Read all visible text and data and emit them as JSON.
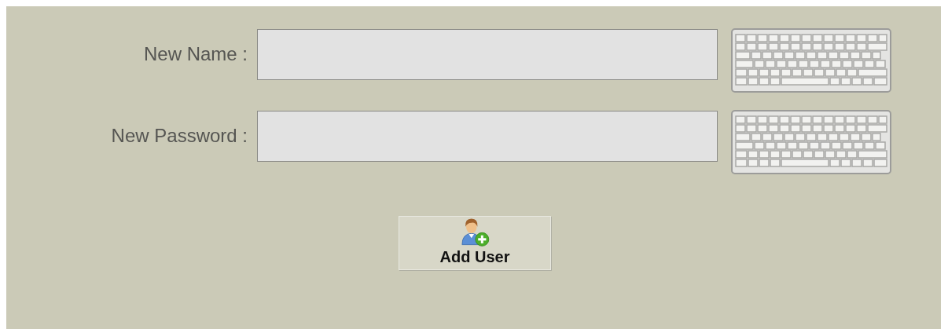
{
  "fields": [
    {
      "label": "New Name :"
    },
    {
      "label": "New Password :"
    }
  ],
  "button": {
    "label": "Add User"
  }
}
